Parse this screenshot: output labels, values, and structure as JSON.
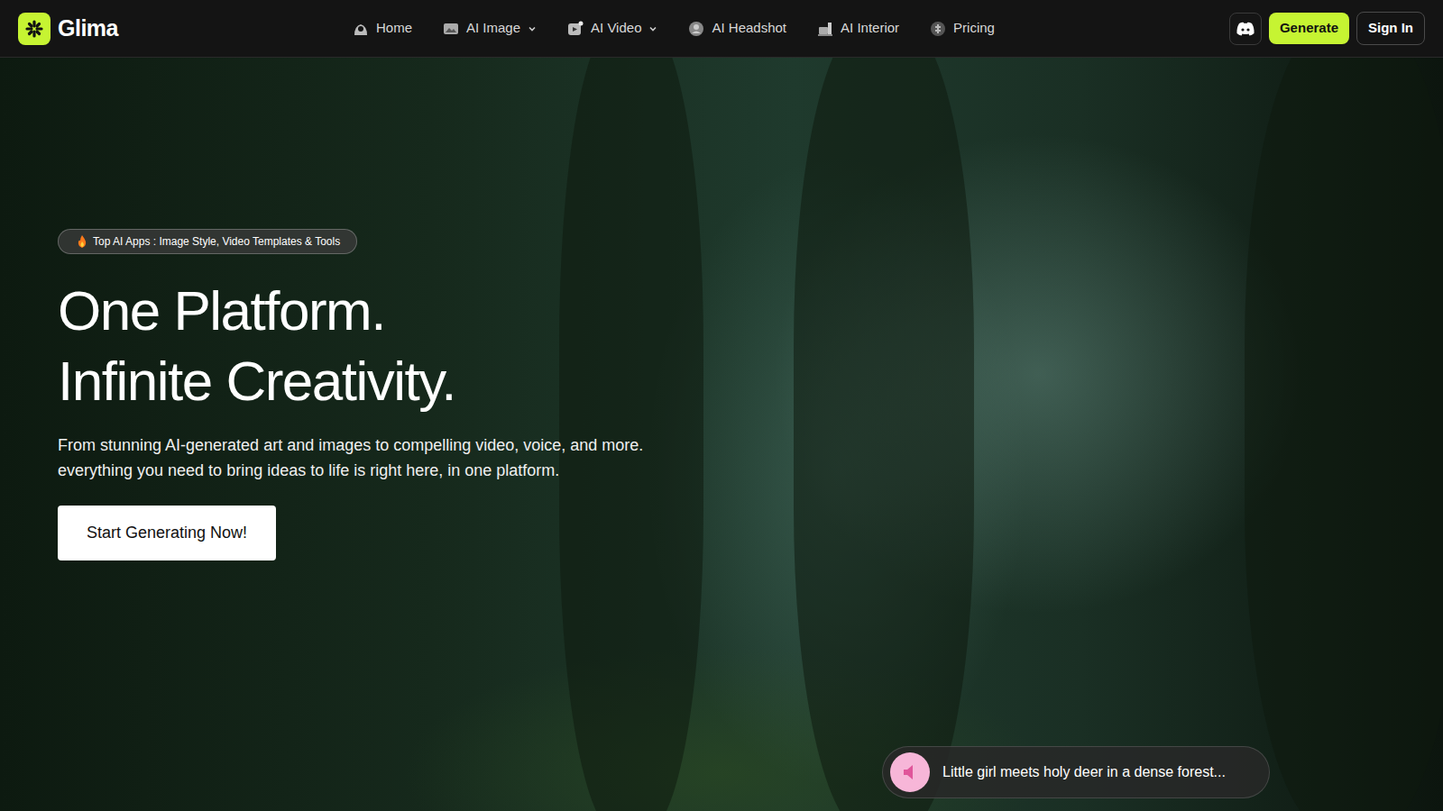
{
  "brand": "Glima",
  "nav": [
    {
      "label": "Home",
      "kind": "link"
    },
    {
      "label": "AI Image",
      "kind": "dropdown"
    },
    {
      "label": "AI Video",
      "kind": "dropdown"
    },
    {
      "label": "AI Headshot",
      "kind": "link"
    },
    {
      "label": "AI Interior",
      "kind": "link"
    },
    {
      "label": "Pricing",
      "kind": "link"
    }
  ],
  "actions": {
    "generate": "Generate",
    "sign_in": "Sign In"
  },
  "hero": {
    "badge": "Top AI Apps : Image Style, Video Templates & Tools",
    "title_lines": [
      "One Platform.",
      "Infinite Creativity."
    ],
    "text": "From stunning AI-generated art and images to compelling video, voice, and more. everything you need to bring ideas to life is right here, in one platform.",
    "button": "Start Generating Now!",
    "caption": "Little girl meets holy deer in a dense forest..."
  }
}
